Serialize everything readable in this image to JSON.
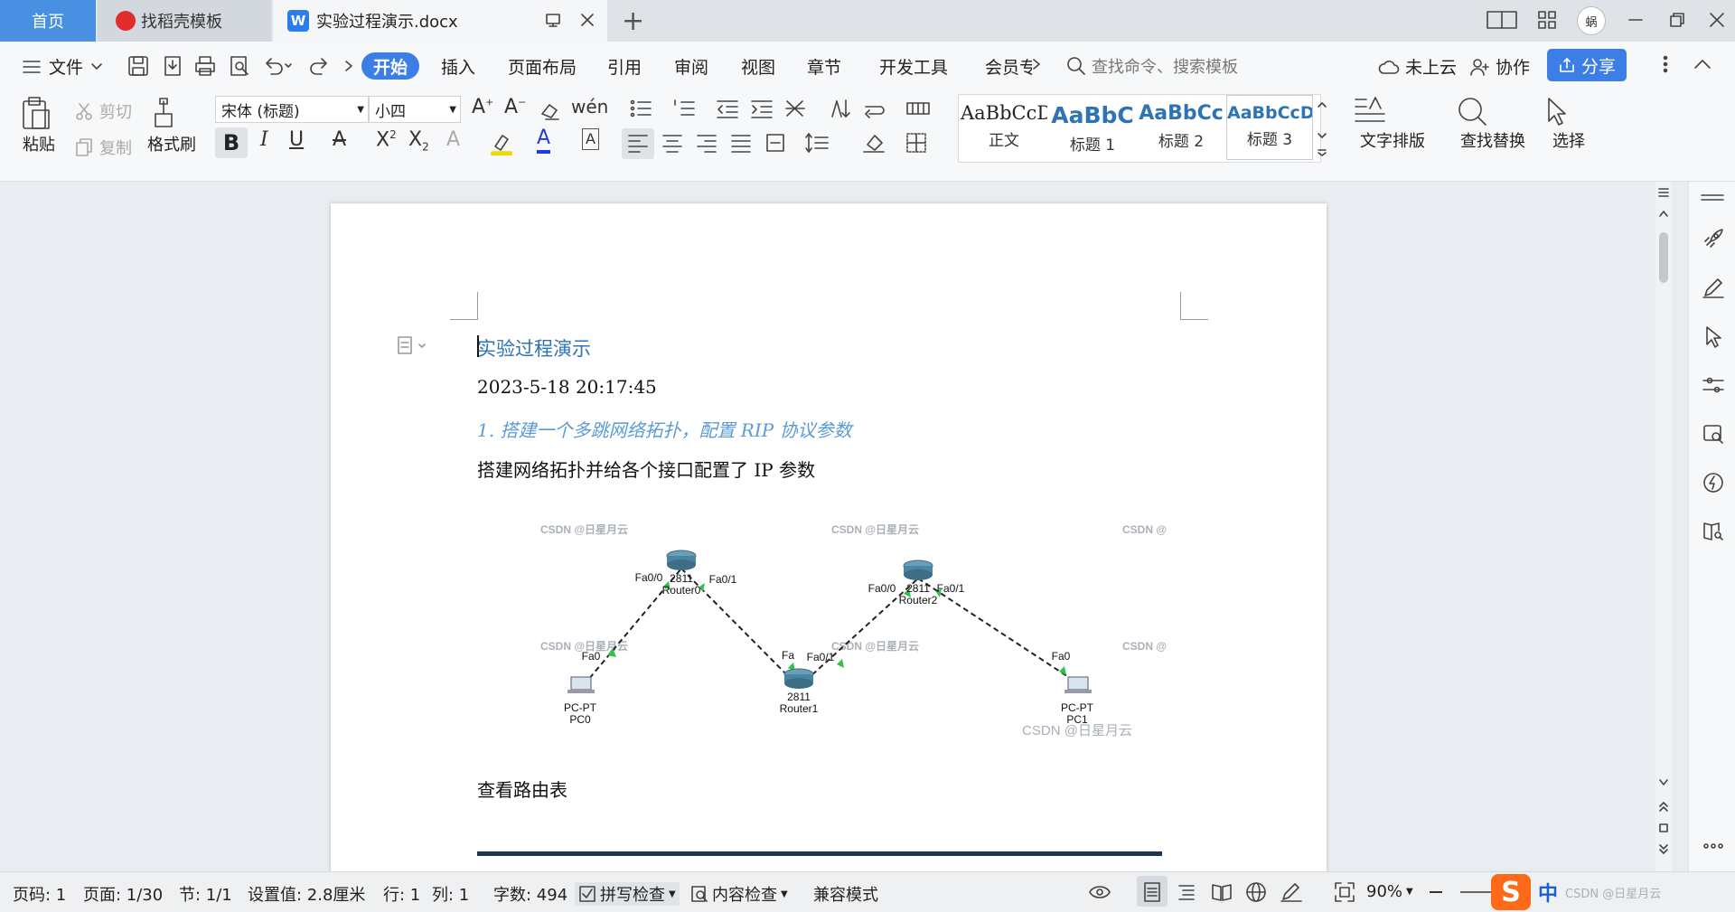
{
  "tabs": {
    "home": "首页",
    "template": "找稻壳模板",
    "document": "实验过程演示.docx"
  },
  "titlebar": {
    "avatar_text": "蜗"
  },
  "menubar": {
    "file": "文件",
    "items": [
      "开始",
      "插入",
      "页面布局",
      "引用",
      "审阅",
      "视图",
      "章节",
      "开发工具",
      "会员专"
    ],
    "search_placeholder": "查找命令、搜索模板",
    "cloud": "未上云",
    "collab": "协作",
    "share": "分享"
  },
  "ribbon": {
    "paste": "粘贴",
    "cut": "剪切",
    "copy": "复制",
    "format_painter": "格式刷",
    "font_name": "宋体 (标题)",
    "font_size": "小四",
    "styles": [
      {
        "sample": "AaBbCcD",
        "name": "正文"
      },
      {
        "sample": "AaBbC",
        "name": "标题 1"
      },
      {
        "sample": "AaBbCc",
        "name": "标题 2"
      },
      {
        "sample": "AaBbCcD",
        "name": "标题 3"
      }
    ],
    "text_layout": "文字排版",
    "find_replace": "查找替换",
    "select": "选择"
  },
  "document": {
    "title": "实验过程演示",
    "date": "2023-5-18 20:17:45",
    "heading1": "1. 搭建一个多跳网络拓扑，配置 RIP 协议参数",
    "para1": "搭建网络拓扑并给各个接口配置了 IP 参数",
    "para2": "查看路由表",
    "topology": {
      "watermark": "CSDN @日星月云",
      "watermark_partial": "CSDN @",
      "router0": {
        "model": "2811",
        "name": "Router0",
        "left_port": "Fa0/0",
        "right_port": "Fa0/1"
      },
      "router1": {
        "model": "2811",
        "name": "Router1",
        "left_port": "Fa",
        "right_port": "Fa0/1"
      },
      "router2": {
        "model": "2811",
        "name": "Router2",
        "left_port": "Fa0/0",
        "right_port": "Fa0/1"
      },
      "pc0": {
        "type": "PC-PT",
        "name": "PC0",
        "port": "Fa0"
      },
      "pc1": {
        "type": "PC-PT",
        "name": "PC1",
        "port": "Fa0"
      }
    }
  },
  "statusbar": {
    "page_no": "页码: 1",
    "pages": "页面: 1/30",
    "section": "节: 1/1",
    "setting": "设置值: 2.8厘米",
    "row": "行: 1",
    "col": "列: 1",
    "word_count": "字数: 494",
    "spell_check": "拼写检查",
    "content_check": "内容检查",
    "compat_mode": "兼容模式",
    "zoom": "90%",
    "ime_mode": "中",
    "ime_watermark": "CSDN @日星月云"
  },
  "colors": {
    "accent": "#3c7ee6",
    "home_tab": "#4a90e2",
    "doc_title": "#2e74b5",
    "heading1": "#5b9bd5",
    "ime": "#ff6a1a"
  }
}
